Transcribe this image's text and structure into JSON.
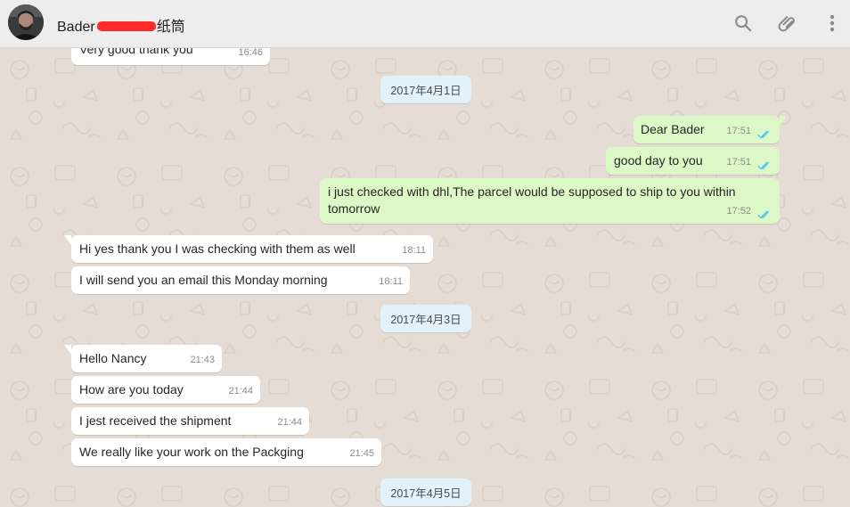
{
  "header": {
    "contact_prefix": "Bader",
    "contact_suffix": "纸筒",
    "icons": [
      "search-icon",
      "paperclip-icon",
      "menu-icon"
    ]
  },
  "messages": [
    {
      "type": "in",
      "text": "Very good thank you",
      "time": "16:46"
    },
    {
      "type": "date",
      "text": "2017年4月1日"
    },
    {
      "type": "out",
      "text": "Dear Bader",
      "time": "17:51",
      "status": "read"
    },
    {
      "type": "out",
      "text": "good day to you",
      "time": "17:51",
      "status": "read"
    },
    {
      "type": "out",
      "text": "i just checked with dhl,The parcel would be supposed to ship to you within tomorrow",
      "time": "17:52",
      "status": "read"
    },
    {
      "type": "in",
      "text": "Hi yes thank you I was checking with them as well",
      "time": "18:11"
    },
    {
      "type": "in",
      "text": "I will send you an email this Monday morning",
      "time": "18:11"
    },
    {
      "type": "date",
      "text": "2017年4月3日"
    },
    {
      "type": "in",
      "text": "Hello Nancy",
      "time": "21:43"
    },
    {
      "type": "in",
      "text": "How are you today",
      "time": "21:44"
    },
    {
      "type": "in",
      "text": "I jest received the shipment",
      "time": "21:44"
    },
    {
      "type": "in",
      "text": "We really like your work on the Packging",
      "time": "21:45"
    },
    {
      "type": "date",
      "text": "2017年4月5日"
    }
  ],
  "colors": {
    "header_bg": "#ededed",
    "chat_bg": "#e5ddd5",
    "incoming_bubble": "#ffffff",
    "outgoing_bubble": "#dcf8c6",
    "date_pill": "#e1f2fb",
    "read_ticks": "#4fc3f7"
  }
}
